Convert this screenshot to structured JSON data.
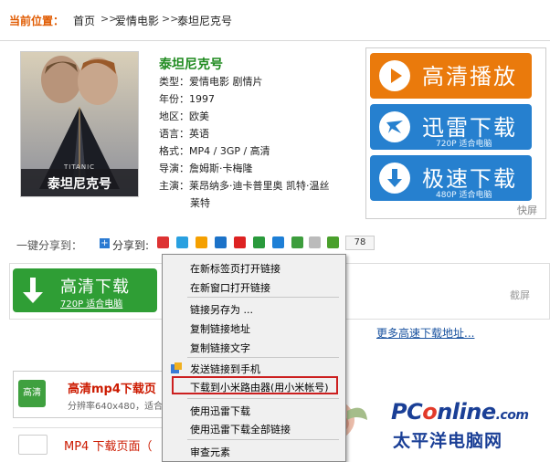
{
  "breadcrumb": {
    "label": "当前位置：",
    "items": [
      "首页",
      "爱情电影",
      "泰坦尼克号"
    ],
    "separator": ">>"
  },
  "movie": {
    "title": "泰坦尼克号",
    "poster_caption_en": "TITANIC",
    "poster_caption_cn": "泰坦尼克号",
    "info": [
      {
        "label": "类型：",
        "value": "爱情电影 剧情片"
      },
      {
        "label": "年份：",
        "value": "1997"
      },
      {
        "label": "地区：",
        "value": "欧美"
      },
      {
        "label": "语言：",
        "value": "英语"
      },
      {
        "label": "格式：",
        "value": "MP4 / 3GP / 高清"
      },
      {
        "label": "导演：",
        "value": "詹姆斯·卡梅隆"
      },
      {
        "label": "主演：",
        "value": "莱昂纳多·迪卡普里奥 凯特·温丝"
      },
      {
        "label": "",
        "value": "莱特"
      }
    ]
  },
  "actions": {
    "play": {
      "label": "高清播放",
      "color": "#ea7a0c"
    },
    "thunder": {
      "label": "迅雷下载",
      "sub": "720P 适合电脑",
      "color": "#2680cf"
    },
    "fast": {
      "label": "极速下载",
      "sub": "480P 适合电脑",
      "color": "#2680cf"
    },
    "kuaiping": "快屏"
  },
  "share": {
    "label": "一键分享到：",
    "to": "分享到:",
    "count": "78",
    "icon_colors": [
      "#d33",
      "#29a0e0",
      "#f5a000",
      "#1c72c8",
      "#d22",
      "#2a9a3c",
      "#1e7fd6",
      "#3d9d3d",
      "#aaa",
      "#4aa02c"
    ]
  },
  "hd_download": {
    "label": "高清下载",
    "sub": "720P 适合电脑",
    "jieping": "截屏",
    "more_link": "更多高速下载地址..."
  },
  "mp4": {
    "title": "高清mp4下载页",
    "sub": "分辨率640x480，适合",
    "icon_label": "高清",
    "title2": "MP4 下载页面（"
  },
  "context_menu": {
    "items": [
      "在新标签页打开链接",
      "在新窗口打开链接",
      "链接另存为 ...",
      "复制链接地址",
      "复制链接文字",
      "发送链接到手机",
      "下载到小米路由器(用小米帐号)",
      "使用迅雷下载",
      "使用迅雷下载全部链接",
      "审查元素"
    ]
  },
  "watermark": {
    "logo_p": "PC",
    "logo_o": "o",
    "logo_rest": "nline",
    "logo_suffix": ".com",
    "cn": "太平洋电脑网"
  }
}
